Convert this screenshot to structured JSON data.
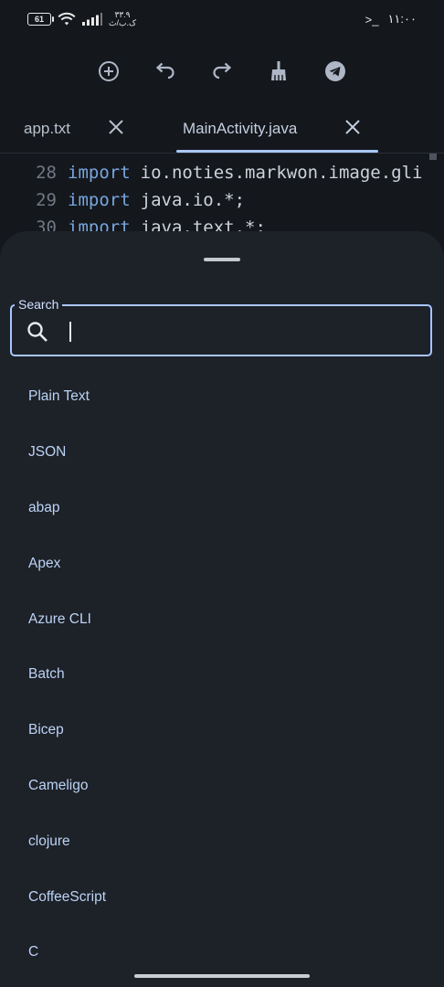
{
  "status_bar": {
    "battery": "61",
    "carrier": "۳۳.۹",
    "carrier_sub": "ک.ب/ث",
    "time": "۱۱:۰۰",
    "terminal_glyph": ">_"
  },
  "toolbar": {
    "icons": [
      "add-circle-icon",
      "undo-icon",
      "redo-icon",
      "broom-icon",
      "telegram-icon"
    ]
  },
  "tabs": [
    {
      "label": "app.txt",
      "active": false
    },
    {
      "label": "MainActivity.java",
      "active": true
    }
  ],
  "editor": {
    "lines": [
      {
        "number": "28",
        "keyword": "import",
        "text": "io.noties.markwon.image.gli"
      },
      {
        "number": "29",
        "keyword": "import",
        "text": "java.io.*;"
      },
      {
        "number": "30",
        "keyword": "import",
        "text": "java.text.*;"
      }
    ]
  },
  "sheet": {
    "search": {
      "label": "Search",
      "value": "",
      "placeholder": ""
    },
    "languages": [
      "Plain Text",
      "JSON",
      "abap",
      "Apex",
      "Azure CLI",
      "Batch",
      "Bicep",
      "Cameligo",
      "clojure",
      "CoffeeScript",
      "C"
    ]
  },
  "colors": {
    "accent": "#aac7ff",
    "background": "#14171c",
    "sheet": "#1d2128",
    "keyword": "#78a6de",
    "list_text": "#bcd3f5"
  }
}
